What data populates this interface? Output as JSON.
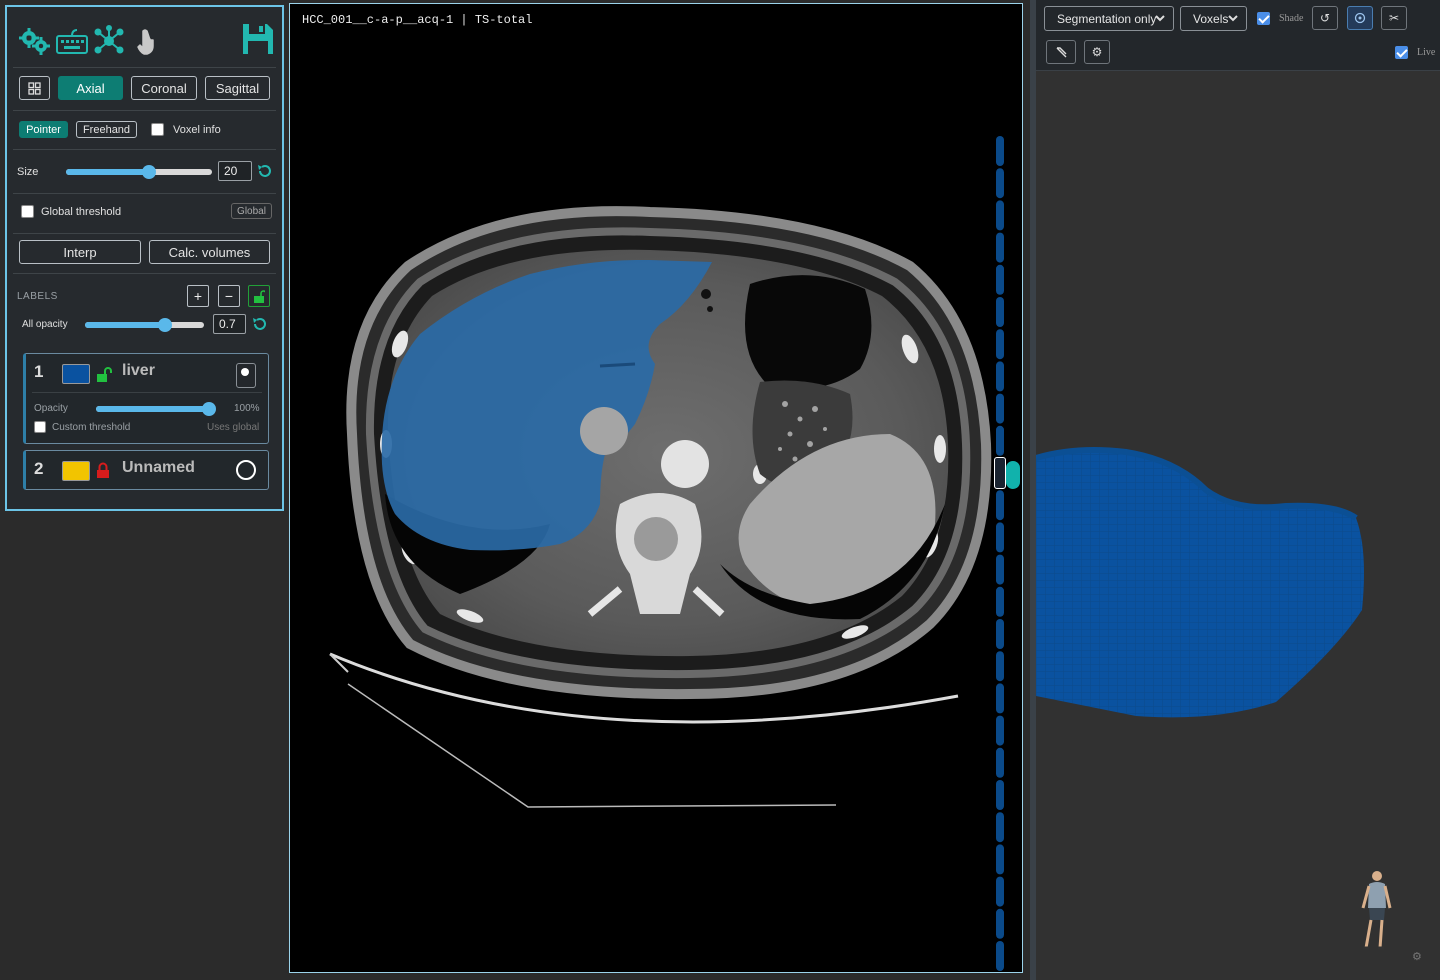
{
  "toolbar": {
    "icons": [
      "settings-gears-icon",
      "keyboard-icon",
      "network-icon",
      "pointer-hand-icon",
      "save-icon"
    ],
    "layout_icon": "grid-layout-icon"
  },
  "views": {
    "axial": "Axial",
    "coronal": "Coronal",
    "sagittal": "Sagittal",
    "active": "Axial"
  },
  "tools": {
    "pointer": "Pointer",
    "freehand": "Freehand",
    "voxel_info": "Voxel info",
    "active": "Pointer"
  },
  "brush": {
    "size_label": "Size",
    "size_value": "20",
    "size_fraction": 0.57
  },
  "threshold": {
    "global_label": "Global threshold",
    "global_badge": "Global"
  },
  "actions": {
    "interp": "Interp",
    "calc_volumes": "Calc. volumes"
  },
  "labels_section": {
    "title": "LABELS",
    "add": "+",
    "remove": "−",
    "all_opacity_label": "All opacity",
    "all_opacity_value": "0.7",
    "all_opacity_fraction": 0.67
  },
  "labels": [
    {
      "number": "1",
      "name": "liver",
      "color": "#0a52a0",
      "locked": false,
      "selected": true,
      "opacity_label": "Opacity",
      "opacity_value": "100%",
      "opacity_fraction": 1.0,
      "custom_threshold": "Custom threshold",
      "threshold_note": "Uses global"
    },
    {
      "number": "2",
      "name": "Unnamed",
      "color": "#f2c400",
      "locked": true,
      "selected": false
    }
  ],
  "viewer": {
    "title": "HCC_001__c-a-p__acq-1 | TS-total"
  },
  "three_d": {
    "display_mode": "Segmentation only",
    "render_mode": "Voxels",
    "shade": "Shade",
    "live": "Live",
    "segment_color": "#0a52a0"
  }
}
